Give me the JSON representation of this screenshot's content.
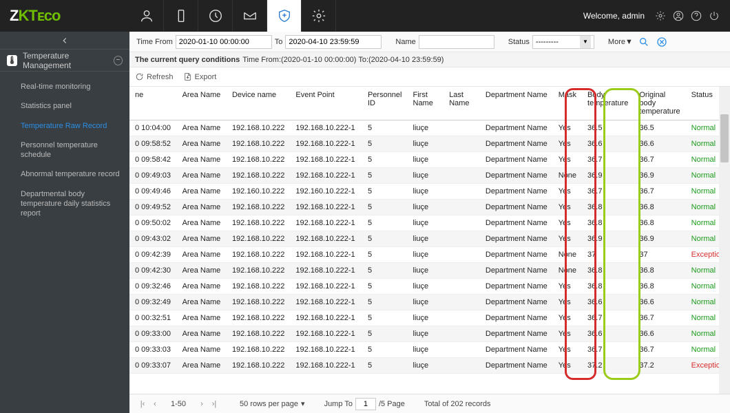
{
  "header": {
    "welcome": "Welcome, admin"
  },
  "sidebar": {
    "section": "Temperature Management",
    "items": [
      "Real-time monitoring",
      "Statistics panel",
      "Temperature Raw Record",
      "Personnel temperature schedule",
      "Abnormal temperature record",
      "Departmental body temperature daily statistics report"
    ]
  },
  "filter": {
    "timeFromLabel": "Time From",
    "timeFrom": "2020-01-10 00:00:00",
    "toLabel": "To",
    "timeTo": "2020-04-10 23:59:59",
    "nameLabel": "Name",
    "nameVal": "",
    "statusLabel": "Status",
    "statusVal": "---------",
    "moreLabel": "More▼"
  },
  "queryCond": {
    "label": "The current query conditions",
    "text": "Time From:(2020-01-10 00:00:00)  To:(2020-04-10 23:59:59)"
  },
  "toolbar": {
    "refresh": "Refresh",
    "export": "Export"
  },
  "columns": [
    "ne",
    "Area Name",
    "Device name",
    "Event Point",
    "Personnel ID",
    "First Name",
    "Last Name",
    "Department Name",
    "Mask",
    "Body temperature",
    "Original body temperature",
    "Status"
  ],
  "rows": [
    {
      "t": "0 10:04:00",
      "area": "Area Name",
      "dev": "192.168.10.222",
      "ep": "192.168.10.222-1",
      "pid": "5",
      "fn": "liuçe",
      "ln": "",
      "dep": "Department Name",
      "mask": "Yes",
      "bt": "36.5",
      "obt": "36.5",
      "st": "Normal"
    },
    {
      "t": "0 09:58:52",
      "area": "Area Name",
      "dev": "192.168.10.222",
      "ep": "192.168.10.222-1",
      "pid": "5",
      "fn": "liuçe",
      "ln": "",
      "dep": "Department Name",
      "mask": "Yes",
      "bt": "36.6",
      "obt": "36.6",
      "st": "Normal"
    },
    {
      "t": "0 09:58:42",
      "area": "Area Name",
      "dev": "192.168.10.222",
      "ep": "192.168.10.222-1",
      "pid": "5",
      "fn": "liuçe",
      "ln": "",
      "dep": "Department Name",
      "mask": "Yes",
      "bt": "36.7",
      "obt": "36.7",
      "st": "Normal"
    },
    {
      "t": "0 09:49:03",
      "area": "Area Name",
      "dev": "192.168.10.222",
      "ep": "192.168.10.222-1",
      "pid": "5",
      "fn": "liuçe",
      "ln": "",
      "dep": "Department Name",
      "mask": "None",
      "bt": "36.9",
      "obt": "36.9",
      "st": "Normal"
    },
    {
      "t": "0 09:49:46",
      "area": "Area Name",
      "dev": "192.160.10.222",
      "ep": "192.160.10.222-1",
      "pid": "5",
      "fn": "liuçe",
      "ln": "",
      "dep": "Department Name",
      "mask": "Yes",
      "bt": "36.7",
      "obt": "36.7",
      "st": "Normal"
    },
    {
      "t": "0 09:49:52",
      "area": "Area Name",
      "dev": "192.168.10.222",
      "ep": "192.168.10.222-1",
      "pid": "5",
      "fn": "liuçe",
      "ln": "",
      "dep": "Department Name",
      "mask": "Yes",
      "bt": "36.8",
      "obt": "36.8",
      "st": "Normal"
    },
    {
      "t": "0 09:50:02",
      "area": "Area Name",
      "dev": "192.168.10.222",
      "ep": "192.168.10.222-1",
      "pid": "5",
      "fn": "liuçe",
      "ln": "",
      "dep": "Department Name",
      "mask": "Yes",
      "bt": "36.8",
      "obt": "36.8",
      "st": "Normal"
    },
    {
      "t": "0 09:43:02",
      "area": "Area Name",
      "dev": "192.168.10.222",
      "ep": "192.168.10.222-1",
      "pid": "5",
      "fn": "liuçe",
      "ln": "",
      "dep": "Department Name",
      "mask": "Yes",
      "bt": "36.9",
      "obt": "36.9",
      "st": "Normal"
    },
    {
      "t": "0 09:42:39",
      "area": "Area Name",
      "dev": "192.168.10.222",
      "ep": "192.168.10.222-1",
      "pid": "5",
      "fn": "liuçe",
      "ln": "",
      "dep": "Department Name",
      "mask": "None",
      "bt": "37",
      "obt": "37",
      "st": "Exception"
    },
    {
      "t": "0 09:42:30",
      "area": "Area Name",
      "dev": "192.168.10.222",
      "ep": "192.168.10.222-1",
      "pid": "5",
      "fn": "liuçe",
      "ln": "",
      "dep": "Department Name",
      "mask": "None",
      "bt": "36.8",
      "obt": "36.8",
      "st": "Normal"
    },
    {
      "t": "0 09:32:46",
      "area": "Area Name",
      "dev": "192.168.10.222",
      "ep": "192.168.10.222-1",
      "pid": "5",
      "fn": "liuçe",
      "ln": "",
      "dep": "Department Name",
      "mask": "Yes",
      "bt": "36.8",
      "obt": "36.8",
      "st": "Normal"
    },
    {
      "t": "0 09:32:49",
      "area": "Area Name",
      "dev": "192.168.10.222",
      "ep": "192.168.10.222-1",
      "pid": "5",
      "fn": "liuçe",
      "ln": "",
      "dep": "Department Name",
      "mask": "Yes",
      "bt": "36.6",
      "obt": "36.6",
      "st": "Normal"
    },
    {
      "t": "0 00:32:51",
      "area": "Area Name",
      "dev": "192.168.10.222",
      "ep": "192.168.10.222-1",
      "pid": "5",
      "fn": "liuçe",
      "ln": "",
      "dep": "Department Name",
      "mask": "Yes",
      "bt": "36.7",
      "obt": "36.7",
      "st": "Normal"
    },
    {
      "t": "0 09:33:00",
      "area": "Area Name",
      "dev": "192.168.10.222",
      "ep": "192.168.10.222-1",
      "pid": "5",
      "fn": "liuçe",
      "ln": "",
      "dep": "Department Name",
      "mask": "Yes",
      "bt": "36.6",
      "obt": "36.6",
      "st": "Normal"
    },
    {
      "t": "0 09:33:03",
      "area": "Area Name",
      "dev": "192.168.10.222",
      "ep": "192.168.10.222-1",
      "pid": "5",
      "fn": "liuçe",
      "ln": "",
      "dep": "Department Name",
      "mask": "Yes",
      "bt": "36.7",
      "obt": "36.7",
      "st": "Normal"
    },
    {
      "t": "0 09:33:07",
      "area": "Area Name",
      "dev": "192.168.10.222",
      "ep": "192.168.10.222-1",
      "pid": "5",
      "fn": "liuçe",
      "ln": "",
      "dep": "Department Name",
      "mask": "Yes",
      "bt": "37.2",
      "obt": "37.2",
      "st": "Exception"
    }
  ],
  "pager": {
    "range": "1-50",
    "perPage": "50 rows per page",
    "jump": "Jump To",
    "page": "1",
    "totalPages": "/5 Page",
    "totalRec": "Total of 202 records"
  }
}
